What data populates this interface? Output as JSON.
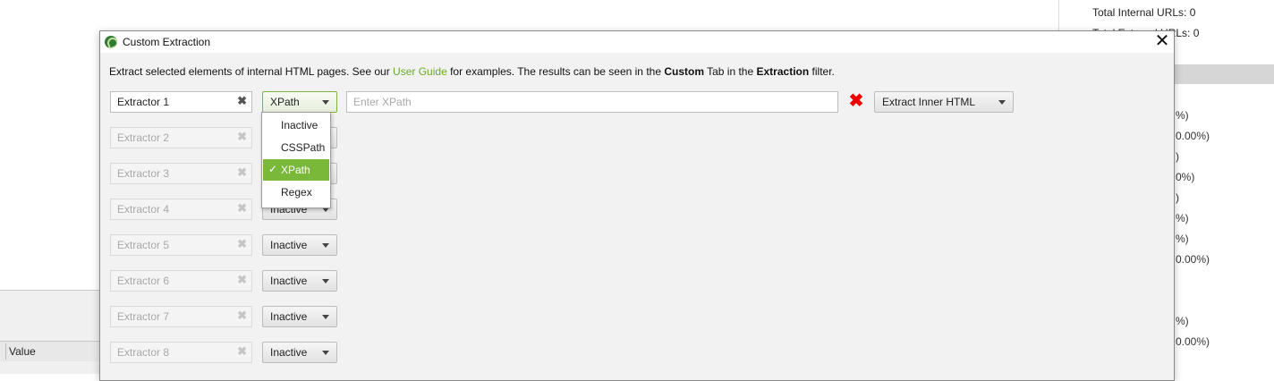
{
  "background": {
    "total_internal": "Total Internal URLs: 0",
    "total_external": "Total External URLs: 0",
    "percent_fragments": [
      "%)",
      "0.00%)",
      ")",
      "0%)",
      ")",
      "%)",
      "%)",
      "0.00%)",
      "%)",
      "0.00%)"
    ],
    "table_header_value": "Value"
  },
  "dialog": {
    "title": "Custom Extraction",
    "close_symbol": "✕",
    "info": {
      "part1": "Extract selected elements of internal HTML pages. See our ",
      "link": "User Guide",
      "part2": " for examples. The results can be seen in the ",
      "bold1": "Custom",
      "part3": " Tab in the ",
      "bold2": "Extraction",
      "part4": " filter."
    },
    "clear_symbol": "✖",
    "delete_symbol": "✖",
    "extractors": [
      {
        "name": "Extractor 1",
        "type": "XPath"
      },
      {
        "name": "Extractor 2",
        "type": "Inactive"
      },
      {
        "name": "Extractor 3",
        "type": "Inactive"
      },
      {
        "name": "Extractor 4",
        "type": "Inactive"
      },
      {
        "name": "Extractor 5",
        "type": "Inactive"
      },
      {
        "name": "Extractor 6",
        "type": "Inactive"
      },
      {
        "name": "Extractor 7",
        "type": "Inactive"
      },
      {
        "name": "Extractor 8",
        "type": "Inactive"
      }
    ],
    "expression_placeholder": "Enter XPath",
    "extract_mode": "Extract Inner HTML",
    "dropdown": {
      "options": [
        "Inactive",
        "CSSPath",
        "XPath",
        "Regex"
      ],
      "selected": "XPath",
      "check_symbol": "✓"
    }
  },
  "colors": {
    "link": "#6aaa28",
    "selected_option": "#7ab83a",
    "delete_icon": "#ee0000"
  }
}
